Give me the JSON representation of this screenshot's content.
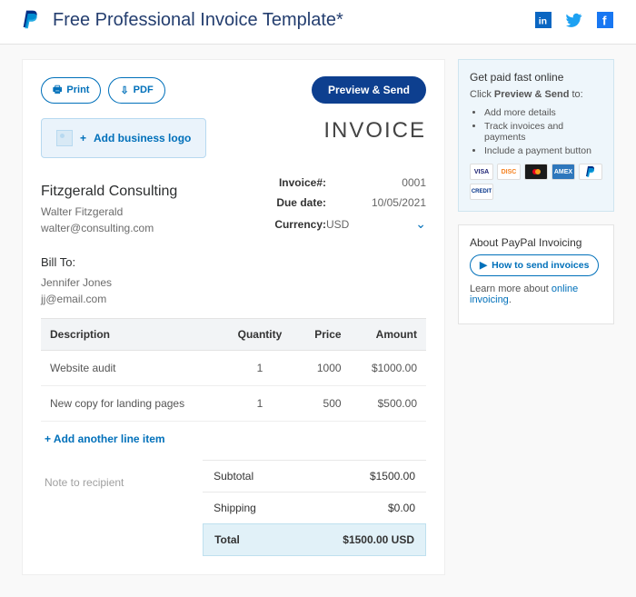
{
  "header": {
    "title": "Free Professional Invoice Template*"
  },
  "toolbar": {
    "print_label": "Print",
    "pdf_label": "PDF",
    "preview_label": "Preview & Send"
  },
  "logo_box_label": "Add business logo",
  "invoice_word": "INVOICE",
  "company": {
    "name": "Fitzgerald Consulting",
    "contact": "Walter Fitzgerald",
    "email": "walter@consulting.com"
  },
  "meta": {
    "invoice_num_label": "Invoice#:",
    "invoice_num": "0001",
    "due_label": "Due date:",
    "due": "10/05/2021",
    "currency_label": "Currency:",
    "currency": "USD"
  },
  "billto": {
    "heading": "Bill To:",
    "name": "Jennifer Jones",
    "email": "jj@email.com"
  },
  "table": {
    "h_desc": "Description",
    "h_qty": "Quantity",
    "h_price": "Price",
    "h_amount": "Amount",
    "rows": [
      {
        "desc": "Website audit",
        "qty": "1",
        "price": "1000",
        "amount": "$1000.00"
      },
      {
        "desc": "New copy for landing pages",
        "qty": "1",
        "price": "500",
        "amount": "$500.00"
      }
    ],
    "add_line": "Add another line item"
  },
  "note_placeholder": "Note to recipient",
  "totals": {
    "subtotal_label": "Subtotal",
    "subtotal": "$1500.00",
    "shipping_label": "Shipping",
    "shipping": "$0.00",
    "total_label": "Total",
    "total": "$1500.00 USD"
  },
  "sidebar": {
    "fast": {
      "title": "Get paid fast online",
      "sub_pre": "Click ",
      "sub_bold": "Preview & Send",
      "sub_post": " to:",
      "items": [
        "Add more details",
        "Track invoices and payments",
        "Include a payment button"
      ]
    },
    "about": {
      "title": "About PayPal Invoicing",
      "video_btn": "How to send invoices",
      "learn_pre": "Learn more about ",
      "learn_link": "online invoicing",
      "learn_post": "."
    }
  }
}
